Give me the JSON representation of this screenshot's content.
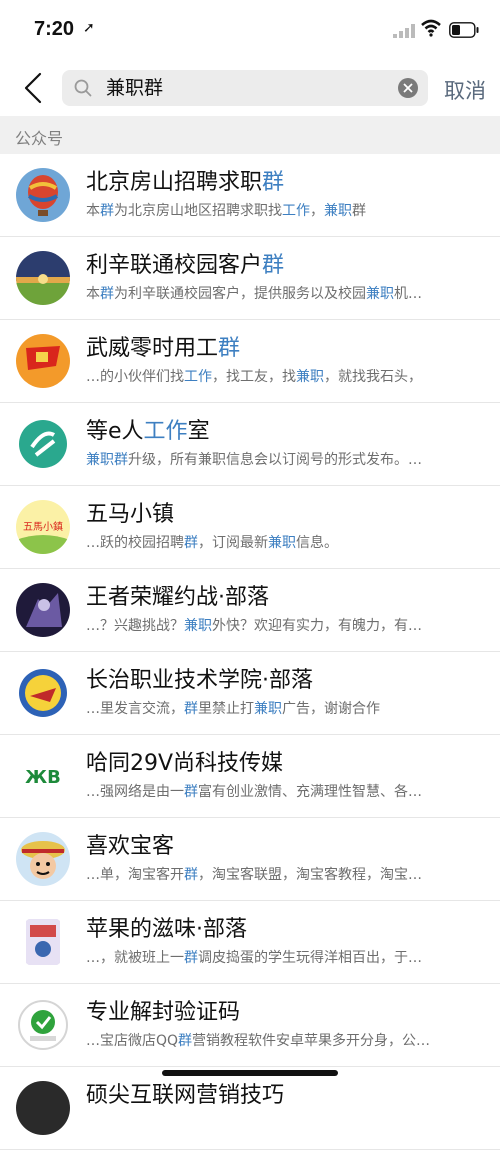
{
  "status_bar": {
    "time": "7:20"
  },
  "search": {
    "query": "兼职群",
    "cancel_label": "取消"
  },
  "section": {
    "label": "公众号"
  },
  "results": [
    {
      "title": [
        [
          "北京房山招聘求职",
          false
        ],
        [
          "群",
          true
        ]
      ],
      "desc": [
        [
          "本",
          false
        ],
        [
          "群",
          true
        ],
        [
          "为北京房山地区招聘求职找",
          false
        ],
        [
          "工作",
          true
        ],
        [
          "，",
          false
        ],
        [
          "兼职",
          true
        ],
        [
          "群",
          false
        ]
      ],
      "avatar": "balloon"
    },
    {
      "title": [
        [
          "利辛联通校园客户",
          false
        ],
        [
          "群",
          true
        ]
      ],
      "desc": [
        [
          "本",
          false
        ],
        [
          "群",
          true
        ],
        [
          "为利辛联通校园客户，提供服务以及校园",
          false
        ],
        [
          "兼职",
          true
        ],
        [
          "机…",
          false
        ]
      ],
      "avatar": "sunset"
    },
    {
      "title": [
        [
          "武威零时用工",
          false
        ],
        [
          "群",
          true
        ]
      ],
      "desc": [
        [
          "…的小伙伴们找",
          false
        ],
        [
          "工作",
          true
        ],
        [
          "，找工友，找",
          false
        ],
        [
          "兼职",
          true
        ],
        [
          "，就找我石头，",
          false
        ]
      ],
      "avatar": "flag"
    },
    {
      "title": [
        [
          "等e人",
          false
        ],
        [
          "工作",
          true
        ],
        [
          "室",
          false
        ]
      ],
      "desc": [
        [
          "兼职群",
          true
        ],
        [
          "升级，所有兼职信息会以订阅号的形式发布。…",
          false
        ]
      ],
      "avatar": "teal-logo"
    },
    {
      "title": [
        [
          "五马小镇",
          false
        ]
      ],
      "desc": [
        [
          "…跃的校园招聘",
          false
        ],
        [
          "群",
          true
        ],
        [
          "，订阅最新",
          false
        ],
        [
          "兼职",
          true
        ],
        [
          "信息。",
          false
        ]
      ],
      "avatar": "wuma"
    },
    {
      "title": [
        [
          "王者荣耀约战·部落",
          false
        ]
      ],
      "desc": [
        [
          "…？兴趣挑战？",
          false
        ],
        [
          "兼职",
          true
        ],
        [
          "外快？欢迎有实力，有魄力，有…",
          false
        ]
      ],
      "avatar": "hero"
    },
    {
      "title": [
        [
          "长治职业技术学院·部落",
          false
        ]
      ],
      "desc": [
        [
          "…里发言交流，",
          false
        ],
        [
          "群",
          true
        ],
        [
          "里禁止打",
          false
        ],
        [
          "兼职",
          true
        ],
        [
          "广告，谢谢合作",
          false
        ]
      ],
      "avatar": "emblem"
    },
    {
      "title": [
        [
          "哈同29V尚科技传媒",
          false
        ]
      ],
      "desc": [
        [
          "…强网络是由一",
          false
        ],
        [
          "群",
          true
        ],
        [
          "富有创业激情、充满理性智慧、各…",
          false
        ]
      ],
      "avatar": "green-text"
    },
    {
      "title": [
        [
          "喜欢宝客",
          false
        ]
      ],
      "desc": [
        [
          "…单，淘宝客开",
          false
        ],
        [
          "群",
          true
        ],
        [
          "，淘宝客联盟，淘宝客教程，淘宝…",
          false
        ]
      ],
      "avatar": "pirate"
    },
    {
      "title": [
        [
          "苹果的滋味·部落",
          false
        ]
      ],
      "desc": [
        [
          "…，就被班上一",
          false
        ],
        [
          "群",
          true
        ],
        [
          "调皮捣蛋的学生玩得洋相百出，于…",
          false
        ]
      ],
      "avatar": "poster"
    },
    {
      "title": [
        [
          "专业解封验证码",
          false
        ]
      ],
      "desc": [
        [
          "…宝店微店QQ",
          false
        ],
        [
          "群",
          true
        ],
        [
          "营销教程软件安卓苹果多开分身，公…",
          false
        ]
      ],
      "avatar": "check"
    },
    {
      "title": [
        [
          "硕尖互联网营销技巧",
          false
        ]
      ],
      "desc": [
        [
          "",
          false
        ]
      ],
      "avatar": "dark"
    }
  ],
  "avatar_texts": {
    "wuma": "五馬小鎮",
    "green_logo": "ЖB"
  }
}
